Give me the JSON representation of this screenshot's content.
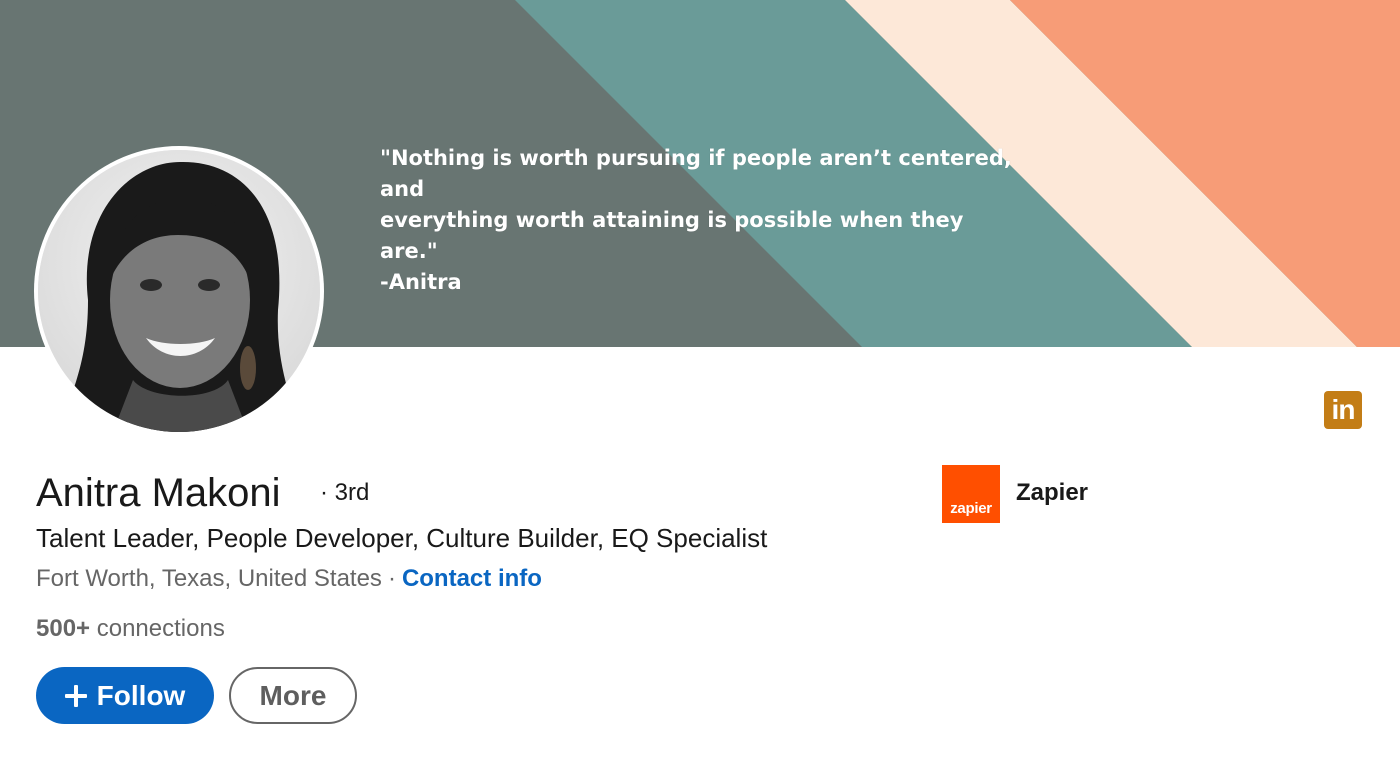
{
  "banner": {
    "quote": "\"Nothing is worth pursuing if people aren’t centered, and\neverything worth attaining is possible when they are.\"\n-Anitra",
    "colors": {
      "slate": "#687572",
      "teal": "#6a9b98",
      "cream": "#fde8d8",
      "salmon": "#f79c77"
    }
  },
  "profile": {
    "name": "Anitra Makoni",
    "degree": "· 3rd",
    "headline": "Talent Leader, People Developer, Culture Builder, EQ Specialist",
    "location": "Fort Worth, Texas, United States",
    "separator": "·",
    "contact_info_label": "Contact info",
    "connections_count": "500+",
    "connections_label": "connections"
  },
  "actions": {
    "follow_label": "Follow",
    "more_label": "More"
  },
  "company": {
    "logo_text": "zapier",
    "name": "Zapier"
  },
  "icons": {
    "linkedin": "linkedin-icon",
    "linkedin_text": "in",
    "follow": "plus-icon"
  },
  "colors": {
    "accent": "#0a66c2",
    "linkedin_badge": "#c37d16",
    "zapier_brand": "#ff4f00"
  }
}
